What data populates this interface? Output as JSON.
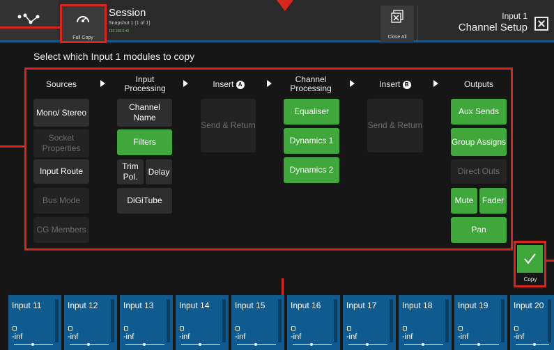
{
  "header": {
    "full_copy_label": "Full Copy",
    "session_title": "Session",
    "snapshot": "Snapshot 1 (1 of 1)",
    "ip": "192.168.0.40",
    "close_all_label": "Close All",
    "input_label": "Input 1",
    "panel_title": "Channel Setup"
  },
  "prompt": "Select which Input 1 modules to copy",
  "columns": {
    "sources": "Sources",
    "input_processing": "Input Processing",
    "insert_a": "Insert",
    "insert_a_badge": "A",
    "channel_processing": "Channel Processing",
    "insert_b": "Insert",
    "insert_b_badge": "B",
    "outputs": "Outputs"
  },
  "sources": {
    "mono_stereo": "Mono/ Stereo",
    "socket_properties": "Socket Properties",
    "input_route": "Input Route",
    "bus_mode": "Bus Mode",
    "cg_members": "CG Members"
  },
  "input_processing": {
    "channel_name": "Channel Name",
    "filters": "Filters",
    "trim_pol": "Trim Pol.",
    "delay": "Delay",
    "digitube": "DiGiTube"
  },
  "insert_a": {
    "send_return": "Send & Return"
  },
  "channel_processing": {
    "equaliser": "Equaliser",
    "dynamics1": "Dynamics 1",
    "dynamics2": "Dynamics 2"
  },
  "insert_b": {
    "send_return": "Send & Return"
  },
  "outputs": {
    "aux_sends": "Aux Sends",
    "group_assigns": "Group Assigns",
    "direct_outs": "Direct Outs",
    "mute": "Mute",
    "fader": "Fader",
    "pan": "Pan"
  },
  "copy_label": "Copy",
  "channel_strips": [
    {
      "name": "Input 11",
      "level": "-inf"
    },
    {
      "name": "Input 12",
      "level": "-inf"
    },
    {
      "name": "Input 13",
      "level": "-inf"
    },
    {
      "name": "Input 14",
      "level": "-inf"
    },
    {
      "name": "Input 15",
      "level": "-inf"
    },
    {
      "name": "Input 16",
      "level": "-inf"
    },
    {
      "name": "Input 17",
      "level": "-inf"
    },
    {
      "name": "Input 18",
      "level": "-inf"
    },
    {
      "name": "Input 19",
      "level": "-inf"
    },
    {
      "name": "Input 20",
      "level": "-inf"
    }
  ],
  "colors": {
    "enabled": "#3fa73c",
    "highlight": "#d9261c",
    "strip": "#0f5a8e"
  }
}
